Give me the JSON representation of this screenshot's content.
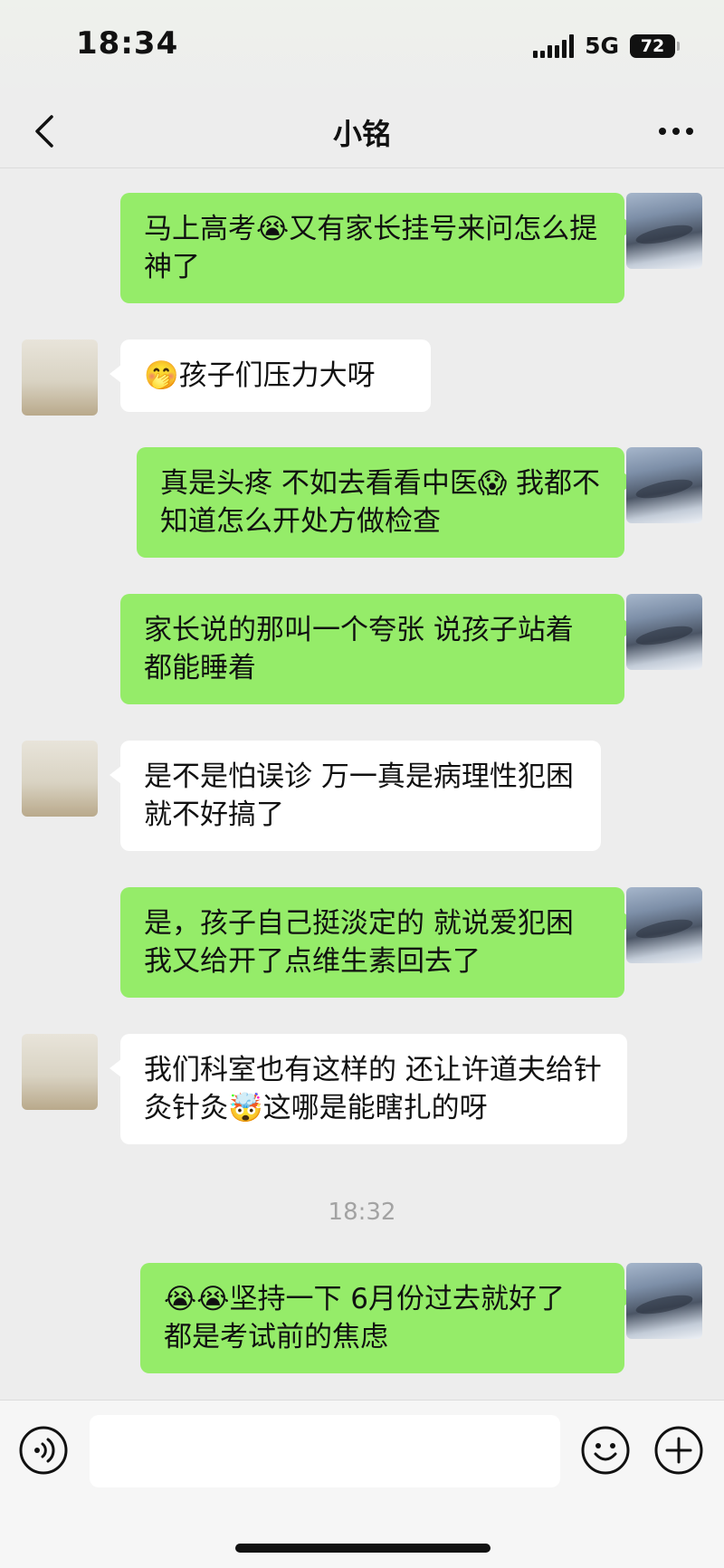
{
  "status_bar": {
    "time": "18:34",
    "network": "5G",
    "battery": "72"
  },
  "header": {
    "title": "小铭",
    "back_icon": "chevron-left-icon",
    "more_icon": "more-dots-icon"
  },
  "messages": [
    {
      "sender": "me",
      "text": "马上高考😭又有家长挂号来问怎么提神了"
    },
    {
      "sender": "other",
      "text": "🤭孩子们压力大呀"
    },
    {
      "sender": "me",
      "text": "真是头疼 不如去看看中医😱 我都不知道怎么开处方做检查"
    },
    {
      "sender": "me",
      "text": "家长说的那叫一个夸张 说孩子站着都能睡着"
    },
    {
      "sender": "other",
      "text": "是不是怕误诊 万一真是病理性犯困 就不好搞了"
    },
    {
      "sender": "me",
      "text": "是，孩子自己挺淡定的 就说爱犯困 我又给开了点维生素回去了"
    },
    {
      "sender": "other",
      "text": "我们科室也有这样的 还让许道夫给针灸针灸🤯这哪是能瞎扎的呀"
    },
    {
      "sender": "me",
      "text": "😭😭坚持一下 6月份过去就好了 都是考试前的焦虑"
    }
  ],
  "timestamp": "18:32",
  "input_bar": {
    "placeholder": "",
    "icons": [
      "voice-icon",
      "emoji-icon",
      "plus-icon"
    ]
  },
  "colors": {
    "my_bubble": "#95ec69",
    "other_bubble": "#ffffff",
    "background": "#ededed"
  }
}
